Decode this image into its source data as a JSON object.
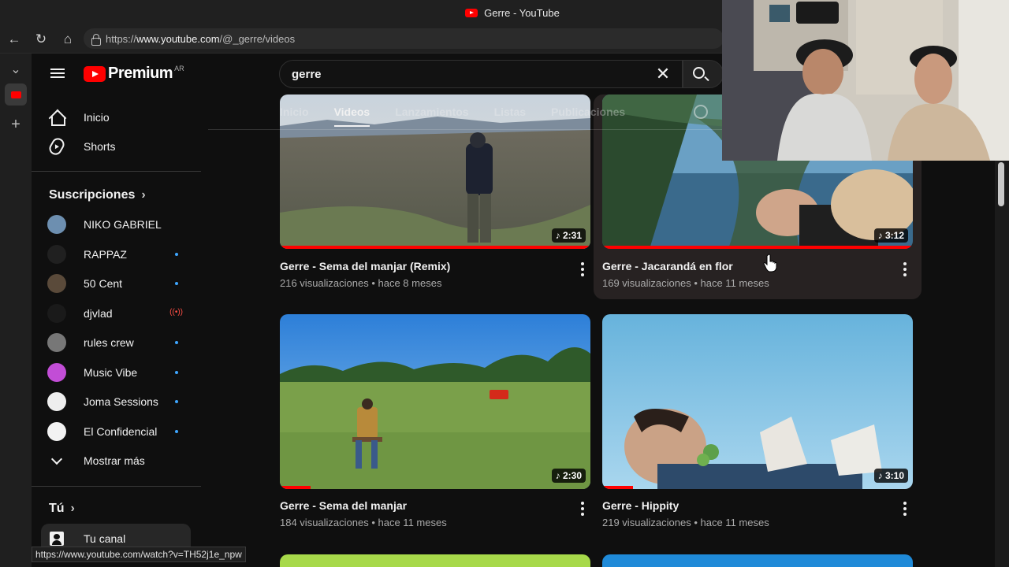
{
  "browser": {
    "tab_title": "Gerre - YouTube",
    "url_prefix": "https://",
    "url_host": "www.youtube.com",
    "url_path": "/@_gerre/videos",
    "status_url": "https://www.youtube.com/watch?v=TH52j1e_npw"
  },
  "masthead": {
    "logo_text": "Premium",
    "region": "AR",
    "search_value": "gerre"
  },
  "sidebar": {
    "home": "Inicio",
    "shorts": "Shorts",
    "subscriptions_heading": "Suscripciones",
    "subscriptions": [
      {
        "name": "NIKO GABRIEL",
        "indicator": "none",
        "color": "#6d8fb0"
      },
      {
        "name": "RAPPAZ",
        "indicator": "dot",
        "color": "#202020"
      },
      {
        "name": "50 Cent",
        "indicator": "dot",
        "color": "#5a4a3a"
      },
      {
        "name": "djvlad",
        "indicator": "live",
        "color": "#1a1a1a"
      },
      {
        "name": "rules crew",
        "indicator": "dot",
        "color": "#777777"
      },
      {
        "name": "Music Vibe",
        "indicator": "dot",
        "color": "#c24dd6"
      },
      {
        "name": "Joma Sessions",
        "indicator": "dot",
        "color": "#eeeeee"
      },
      {
        "name": "El Confidencial",
        "indicator": "dot",
        "color": "#f2f2f2"
      }
    ],
    "show_more": "Mostrar más",
    "you_heading": "Tú",
    "your_channel": "Tu canal"
  },
  "channel_tabs": [
    "Inicio",
    "Videos",
    "Lanzamientos",
    "Listas",
    "Publicaciones"
  ],
  "channel_tabs_active": "Videos",
  "videos": [
    {
      "title": "Gerre - Sema del manjar (Remix)",
      "meta": "216 visualizaciones • hace 8 meses",
      "duration": "2:31",
      "progress": 1.0
    },
    {
      "title": "Gerre - Jacarandá en flor",
      "meta": "169 visualizaciones • hace 11 meses",
      "duration": "3:12",
      "progress": 1.0
    },
    {
      "title": "Gerre - Sema del manjar",
      "meta": "184 visualizaciones • hace 11 meses",
      "duration": "2:30",
      "progress": 0.1
    },
    {
      "title": "Gerre - Hippity",
      "meta": "219 visualizaciones • hace 11 meses",
      "duration": "3:10",
      "progress": 0.1
    }
  ],
  "colors": {
    "accent": "#ff0000",
    "background": "#0f0f0f",
    "notification_dot": "#3ea6ff"
  }
}
